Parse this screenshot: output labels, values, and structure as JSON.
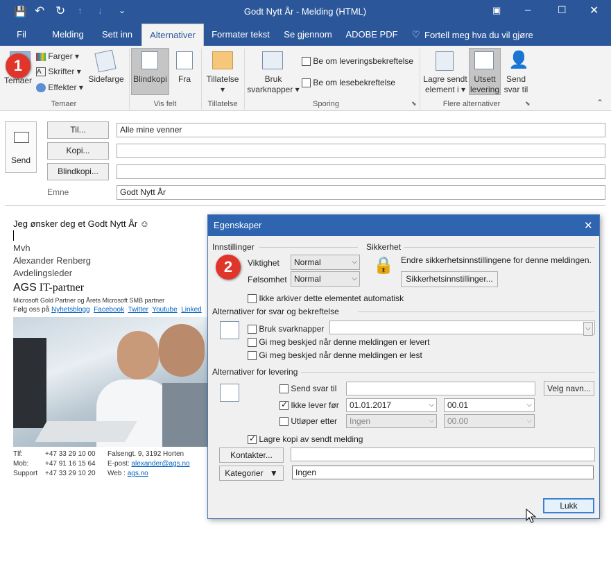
{
  "window": {
    "title": "Godt Nytt År - Melding (HTML)"
  },
  "tabs": [
    "Fil",
    "Melding",
    "Sett inn",
    "Alternativer",
    "Formater tekst",
    "Se gjennom",
    "ADOBE PDF"
  ],
  "tell_me": "Fortell meg hva du vil gjøre",
  "ribbon": {
    "temaer": "Temaer",
    "farger": "Farger",
    "skrifter": "Skrifter",
    "effekter": "Effekter",
    "sidefarge": "Sidefarge",
    "group_temaer": "Temaer",
    "blindkopi": "Blindkopi",
    "fra": "Fra",
    "group_visfelt": "Vis felt",
    "tillatelse": "Tillatelse",
    "group_tillatelse": "Tillatelse",
    "bruk_1": "Bruk",
    "bruk_2": "svarknapper",
    "be_levering": "Be om leveringsbekreftelse",
    "be_lese": "Be om lesebekreftelse",
    "group_sporing": "Sporing",
    "lagre_1": "Lagre sendt",
    "lagre_2": "element i",
    "utsett_1": "Utsett",
    "utsett_2": "levering",
    "send_svar_1": "Send",
    "send_svar_2": "svar til",
    "group_flere": "Flere alternativer"
  },
  "compose": {
    "send": "Send",
    "til_label": "Til...",
    "til_value": "Alle mine venner",
    "kopi_label": "Kopi...",
    "blindkopi_label": "Blindkopi...",
    "emne_label": "Emne",
    "emne_value": "Godt Nytt År"
  },
  "body": {
    "greeting": "Jeg ønsker deg et Godt Nytt År ☺",
    "mvh": "Mvh",
    "name": "Alexander Renberg",
    "role": "Avdelingsleder",
    "company_1": "AGS",
    "company_2": " IT-partner",
    "partner": "Microsoft Gold Partner og Årets Microsoft SMB partner",
    "follow": "Følg oss på",
    "links": [
      "Nyhetsblogg",
      "Facebook",
      "Twitter",
      "Youtube",
      "Linked"
    ],
    "contact": [
      {
        "label": "Tlf:",
        "value": "+47 33 29 10 00",
        "label2": "Falsengt. 9, 3192  Horten",
        "value2": ""
      },
      {
        "label": "Mob:",
        "value": "+47 91 16 15 64",
        "label2": "E-post:",
        "value2": "alexander@ags.no"
      },
      {
        "label": "Support",
        "value": "+47 33 29 10 20",
        "label2": "Web    :",
        "value2": "ags.no"
      }
    ]
  },
  "dialog": {
    "title": "Egenskaper",
    "innstillinger": "Innstillinger",
    "viktighet": "Viktighet",
    "viktighet_value": "Normal",
    "folsomhet": "Følsomhet",
    "folsomhet_value": "Normal",
    "ikke_arkiver": "Ikke arkiver dette elementet automatisk",
    "sikkerhet": "Sikkerhet",
    "sikkerhet_text": "Endre sikkerhetsinnstillingene for denne meldingen.",
    "sikkerhet_button": "Sikkerhetsinnstillinger...",
    "svar_header": "Alternativer for svar og bekreftelse",
    "bruk_svarknapper": "Bruk svarknapper",
    "gi_levert": "Gi meg beskjed når denne meldingen er levert",
    "gi_lest": "Gi meg beskjed når denne meldingen er lest",
    "levering_header": "Alternativer for levering",
    "send_svar_til": "Send svar til",
    "velg_navn": "Velg navn...",
    "ikke_lever_for": "Ikke lever før",
    "date_value": "01.01.2017",
    "time_value": "00.01",
    "utloper_etter": "Utløper etter",
    "utloper_date": "Ingen",
    "utloper_time": "00.00",
    "lagre_kopi": "Lagre kopi av sendt melding",
    "kontakter": "Kontakter...",
    "kategorier": "Kategorier",
    "kategorier_value": "Ingen",
    "lukk": "Lukk"
  },
  "badges": [
    "1",
    "2"
  ],
  "colors": {
    "brand": "#2b579a",
    "dialog_title": "#2e64b0",
    "badge": "#e0352b",
    "link": "#0563c1"
  }
}
